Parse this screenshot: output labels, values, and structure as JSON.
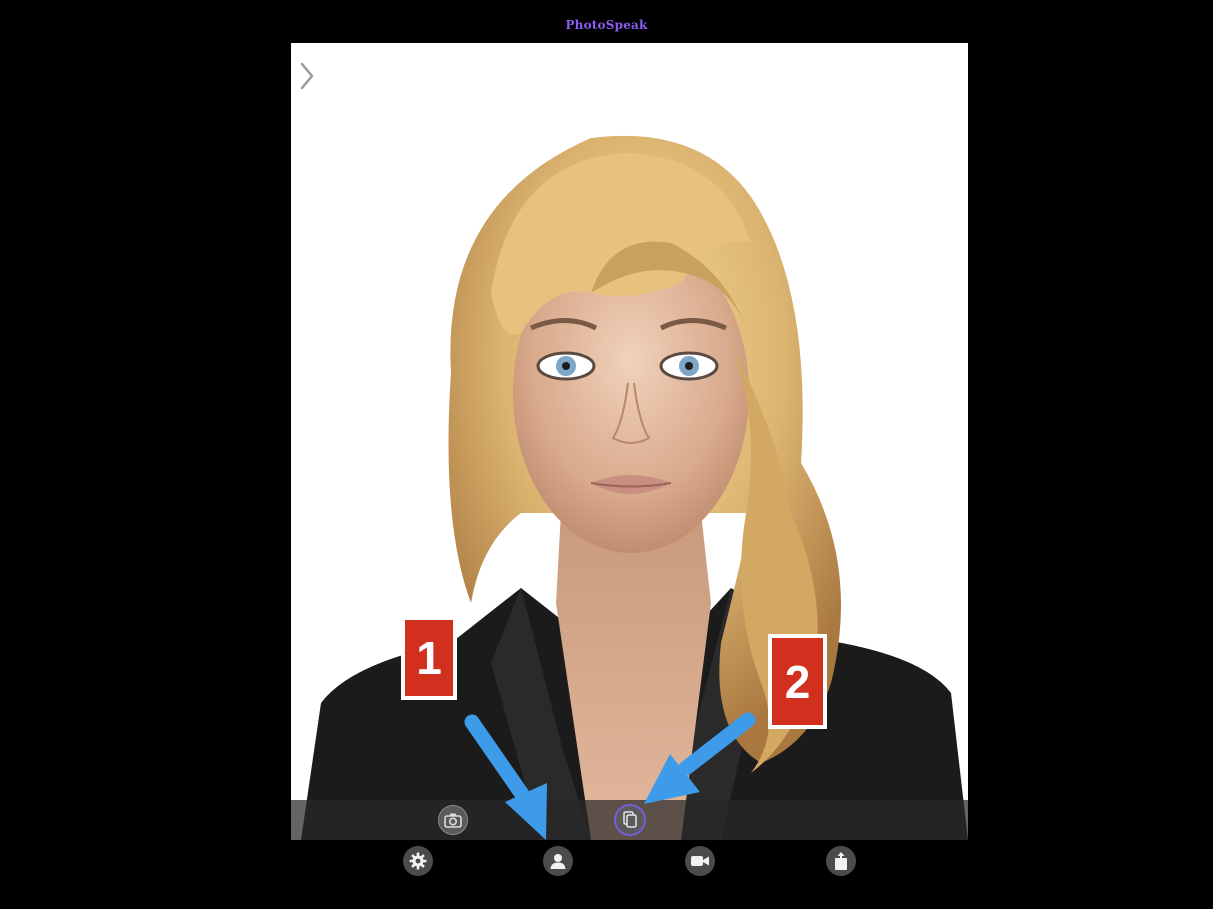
{
  "app": {
    "title": "PhotoSpeak"
  },
  "photo_toolbar": {
    "camera_icon": "camera-icon",
    "copy_icon": "copy-photos-icon"
  },
  "bottom_bar": {
    "settings_icon": "gear-icon",
    "profile_icon": "person-icon",
    "video_icon": "video-camera-icon",
    "share_icon": "share-icon"
  },
  "annotations": {
    "callout_1": "1",
    "callout_2": "2"
  },
  "colors": {
    "background": "#000000",
    "callout_red": "#d2301f",
    "arrow_blue": "#3d9be9",
    "title_purple": "#8a5cf0",
    "copy_button_ring": "#7c5cd6"
  }
}
